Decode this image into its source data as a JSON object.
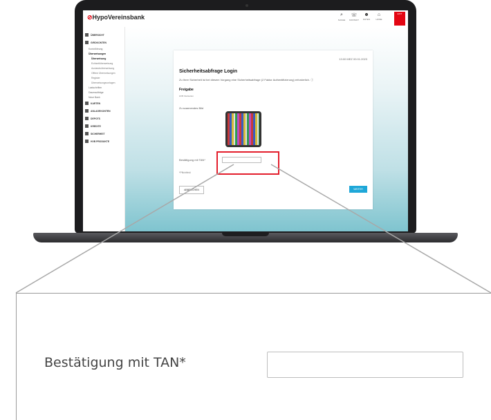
{
  "header": {
    "brand": "HypoVereinsbank",
    "tools": [
      {
        "icon": "search-icon",
        "label": "SUCHE"
      },
      {
        "icon": "phone-icon",
        "label": "KONTAKT"
      },
      {
        "icon": "user-icon",
        "label": "DATEN"
      },
      {
        "icon": "home-icon",
        "label": "HOME"
      }
    ],
    "exit_label": "EXIT"
  },
  "sidebar": {
    "items": [
      {
        "label": "ÜBERSICHT",
        "level": "main"
      },
      {
        "label": "GIROKONTEN",
        "level": "main"
      },
      {
        "label": "Kontoführung",
        "level": "sub"
      },
      {
        "label": "Überweisungen",
        "level": "sub",
        "active": true
      },
      {
        "label": "Überweisung",
        "level": "subsub",
        "active": true
      },
      {
        "label": "Echtzeitüberweisung",
        "level": "subsub"
      },
      {
        "label": "Auslandsüberweisung",
        "level": "subsub"
      },
      {
        "label": "Offene Überweisungen",
        "level": "subsub"
      },
      {
        "label": "Register",
        "level": "subsub"
      },
      {
        "label": "Überweisungsvorlagen",
        "level": "subsub"
      },
      {
        "label": "Lastschriften",
        "level": "sub"
      },
      {
        "label": "Daueraufträge",
        "level": "sub"
      },
      {
        "label": "Neue Bank",
        "level": "sub"
      },
      {
        "label": "KARTEN",
        "level": "main"
      },
      {
        "label": "ANLAGEKONTEN",
        "level": "main"
      },
      {
        "label": "DEPOTS",
        "level": "main"
      },
      {
        "label": "KREDITE",
        "level": "main"
      },
      {
        "label": "SICHERHEIT",
        "level": "main"
      },
      {
        "label": "HVB PRODUKTE",
        "level": "main"
      }
    ]
  },
  "card": {
    "datetime": "13:00 MEZ 00.01.2023",
    "title": "Sicherheitsabfrage Login",
    "description": "Zu Ihrer Sicherheit ist bei diesem Vorgang eine Sicherheitsabfrage (2 Faktor Authentifizierung) erforderlich.",
    "section": "Freigabe",
    "section_sub": "HVB Flexkarten",
    "qr_label": "Zu scannendes Bild",
    "tan_label": "Bestätigung mit TAN*",
    "required_note": "*Pflichtfeld",
    "abort_label": "ABBRECHEN",
    "next_label": "WEITER"
  },
  "zoom": {
    "tan_label": "Bestätigung mit TAN*",
    "tan_value": ""
  },
  "colors": {
    "brand_red": "#e30613",
    "highlight_red": "#e31d2b",
    "accent_blue": "#1ea7d8"
  }
}
